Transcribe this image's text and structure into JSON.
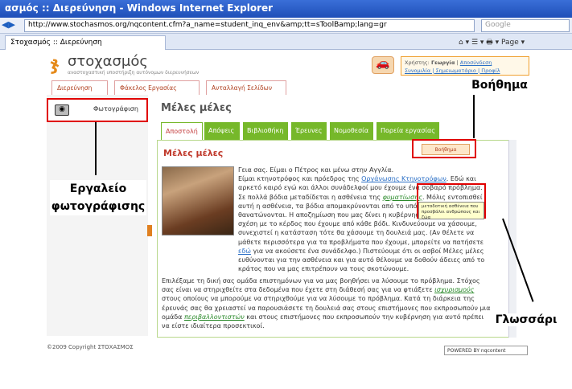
{
  "browser": {
    "title": "ασμός :: Διερεύνηση - Windows Internet Explorer",
    "url": "http://www.stochasmos.org/nqcontent.cfm?a_name=student_inq_env&amp;tt=sToolBamp;lang=gr",
    "search_placeholder": "Google",
    "tab_label": "Στοχασμός :: Διερεύνηση",
    "page_menu": "Page"
  },
  "site": {
    "logo_text": "στοχασμός",
    "logo_sub": "αναστοχαστική υποστήριξη αυτόνομων διερευνήσεων",
    "user_label": "Χρήστης:",
    "user_name": "Γεωργία",
    "logout": "Αποσύνδεση",
    "links": "Συνομιλία | Σημειωματάριο | Προφίλ",
    "top_tabs": [
      "Διερεύνηση",
      "Φάκελος Εργασίας",
      "Ανταλλαγή Σελίδων"
    ],
    "photo_tool": "Φωτογράφιση",
    "main_title": "Μέλες μέλες",
    "green_tabs": [
      "Αποστολή",
      "Απόψεις",
      "Βιβλιοθήκη",
      "Έρευνες",
      "Νομοθεσία",
      "Πορεία εργασίας"
    ],
    "section_title": "Μέλες μέλες",
    "help_button": "Βοήθημα",
    "tooltip_text": "μεταδοτική ασθένεια που προσβάλει ανθρώπους και ζώα",
    "footer": "©2009 Copyright ΣΤΟΧΑΣΜΟΣ",
    "powered": "POWERED BY nqcontent"
  },
  "text": {
    "p1_a": "Γεια σας. Είμαι ο Πέτρος και μένω στην Αγγλία.",
    "p1_b": "Είμαι κτηνοτρόφος και πρόεδρος της ",
    "p1_link": "Οργάνωσης Κτηνοτρόφων",
    "p1_c": ". Εδώ και αρκετό καιρό εγώ και άλλοι συνάδελφοί μου έχουμε ένα σοβαρό πρόβλημα. Σε πολλά βόδια μεταδίδεται η ασθένεια της ",
    "p1_gloss": "φυματίωσης",
    "p1_d": ". Μόλις εντοπισθεί αυτή η ασθένεια, τα βόδια απομακρύνονται από το υπόλοιπο κοπάδι και θανατώνονται. Η αποζημίωση που μας δίνει η κυβέρνηση είναι μικρή σε σχέση με το κέρδος που έχουμε από κάθε βόδι. Κινδυνεύουμε να χάσουμε, συνεχιστεί η κατάσταση τότε θα χάσουμε τη δουλειά μας. (Αν θέλετε να μάθετε περισσότερα για τα προβλήματα που έχουμε, μπορείτε να πατήσετε ",
    "p1_link2": "εδώ",
    "p1_e": " για να ακούσετε ένα συνάδελφο.) Πιστεύουμε ότι οι ασβοί Μέλες μέλες ευθύνονται για την ασθένεια και για αυτό θέλουμε να δοθούν άδειες από το κράτος που να μας επιτρέπουν να τους σκοτώνουμε.",
    "p2_a": "Επιλέξαμε τη δική σας ομάδα επιστημόνων για να μας βοηθήσει να λύσουμε το πρόβλημα. Στόχος σας είναι να στηριχθείτε στα δεδομένα που έχετε στη διάθεσή σας για να φτιάξετε ",
    "p2_gloss": "ισχυρισμούς",
    "p2_b": " στους οποίους να μπορούμε να στηριχθούμε για να λύσουμε το πρόβλημα. Κατά τη διάρκεια της έρευνάς σας θα χρειαστεί να παρουσιάσετε τη δουλειά σας στους επιστήμονες που εκπροσωπούν μια ομάδα ",
    "p2_gloss2": "περιβαλλοντιστών",
    "p2_c": " και στους επιστήμονες που εκπροσωπούν την κυβέρνηση για αυτό πρέπει να είστε ιδιαίτερα προσεκτικοί."
  },
  "annotations": {
    "help": "Βοήθημα",
    "photo_line1": "Εργαλείο",
    "photo_line2": "φωτογράφισης",
    "glossary": "Γλωσσάρι"
  }
}
